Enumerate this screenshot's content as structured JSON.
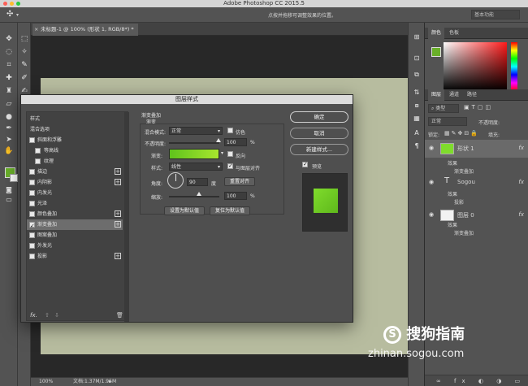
{
  "app": {
    "title": "Adobe Photoshop CC 2015.5"
  },
  "options_bar": {
    "hint": "点按并拖移可调整效果的位置。",
    "workspace": "基本功能"
  },
  "document": {
    "tab_title": "未标题-1 @ 100% (形状 1, RGB/8*) *",
    "zoom": "100%",
    "doc_info": "文档:1.37M/1.95M"
  },
  "color_panel": {
    "tabs": [
      "颜色",
      "色板"
    ],
    "fg_color": "#6ab02a"
  },
  "layers_panel": {
    "tabs": [
      "图层",
      "通道",
      "路径"
    ],
    "kind_filter": "类型",
    "blend_mode": "正常",
    "opacity_label": "不透明度:",
    "lock_label": "锁定:",
    "fill_label": "填充:",
    "layers": [
      {
        "name": "形状 1",
        "effects_label": "效果",
        "effects": [
          "渐变叠加"
        ],
        "fx": "fx"
      },
      {
        "name": "Sogou",
        "effects_label": "效果",
        "effects": [
          "投影"
        ],
        "fx": "fx"
      },
      {
        "name": "图层 0",
        "effects_label": "效果",
        "effects": [
          "渐变叠加"
        ],
        "fx": "fx"
      }
    ]
  },
  "dialog": {
    "title": "图层样式",
    "styles_header": "样式",
    "blend_options": "混合选项",
    "style_items": [
      {
        "label": "斜面和浮雕",
        "plus": false,
        "indent": false
      },
      {
        "label": "等高线",
        "plus": false,
        "indent": true
      },
      {
        "label": "纹理",
        "plus": false,
        "indent": true
      },
      {
        "label": "描边",
        "plus": true,
        "indent": false
      },
      {
        "label": "内阴影",
        "plus": true,
        "indent": false
      },
      {
        "label": "内发光",
        "plus": false,
        "indent": false
      },
      {
        "label": "光泽",
        "plus": false,
        "indent": false
      },
      {
        "label": "颜色叠加",
        "plus": true,
        "indent": false
      },
      {
        "label": "渐变叠加",
        "plus": true,
        "indent": false
      },
      {
        "label": "图案叠加",
        "plus": false,
        "indent": false
      },
      {
        "label": "外发光",
        "plus": false,
        "indent": false
      },
      {
        "label": "投影",
        "plus": true,
        "indent": false
      }
    ],
    "gradient_overlay": {
      "section_title": "渐变叠加",
      "subsection": "渐变",
      "blend_mode_label": "混合模式:",
      "blend_mode_value": "正常",
      "dither_label": "仿色",
      "opacity_label": "不透明度:",
      "opacity_value": "100",
      "percent": "%",
      "gradient_label": "渐变:",
      "reverse_label": "反向",
      "style_label": "样式:",
      "style_value": "线性",
      "align_label": "与图层对齐",
      "angle_label": "角度:",
      "angle_value": "90",
      "degree": "度",
      "reset_align": "重置对齐",
      "scale_label": "缩放:",
      "scale_value": "100",
      "set_default": "设置为默认值",
      "reset_default": "复位为默认值",
      "gradient_from": "#5fc31c",
      "gradient_to": "#a8e62e"
    },
    "buttons": {
      "ok": "确定",
      "cancel": "取消",
      "new_style": "新建样式...",
      "preview": "预览"
    }
  },
  "watermark": {
    "brand": "搜狗指南",
    "url": "zhinan.sogou.com"
  }
}
